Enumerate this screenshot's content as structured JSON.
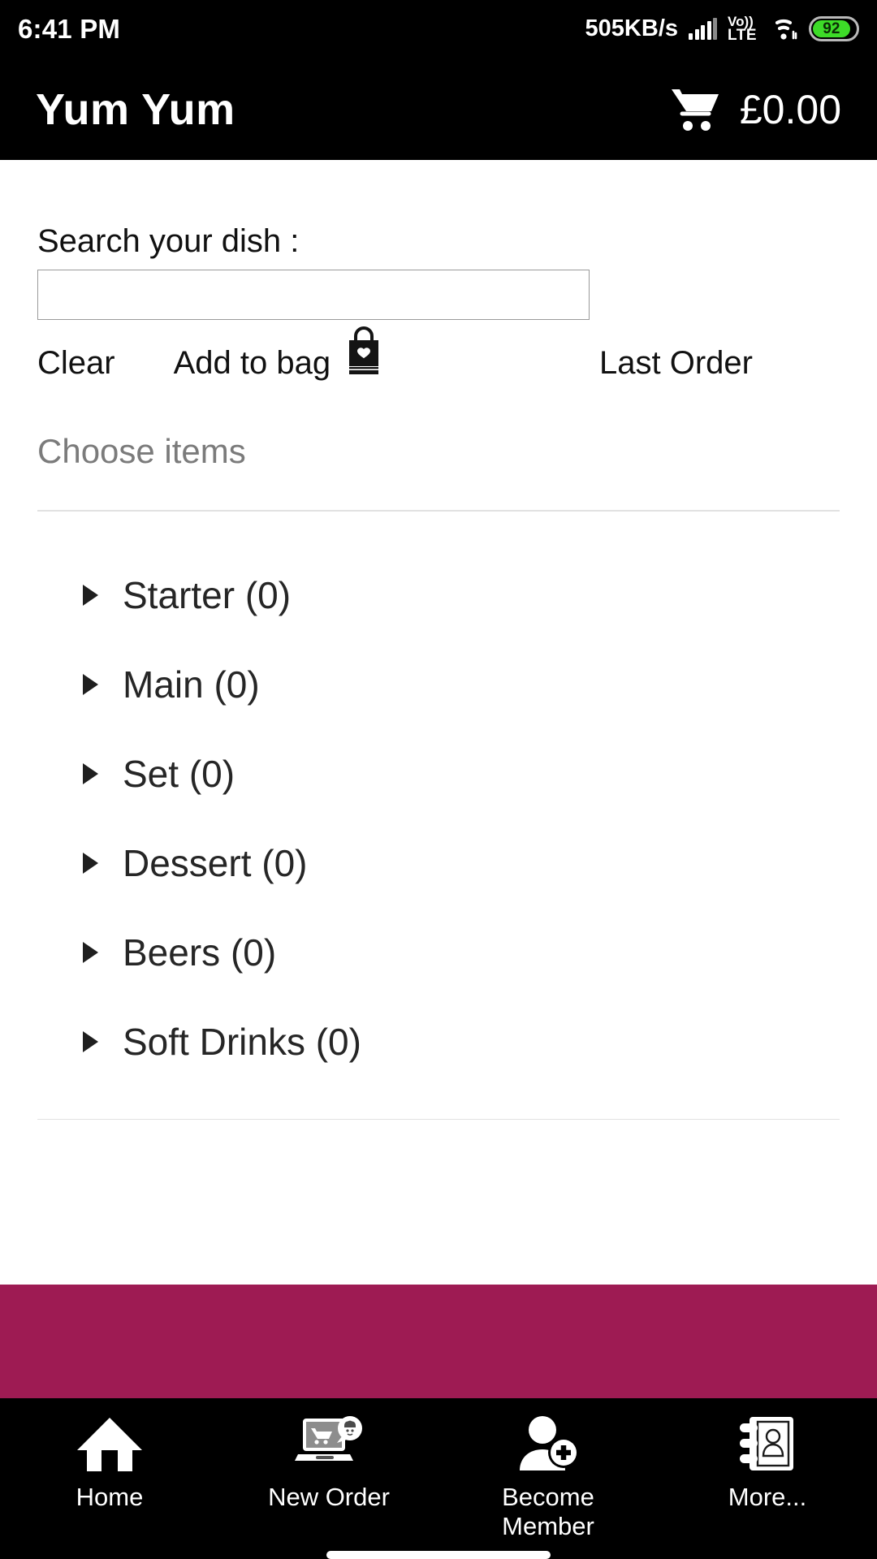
{
  "status_bar": {
    "time": "6:41 PM",
    "network_speed": "505KB/s",
    "signal_icon": "signal-bars-icon",
    "volte_line1": "Vo))",
    "volte_line2": "LTE",
    "wifi_icon": "wifi-icon",
    "battery_level": "92",
    "battery_color": "#3ddc28"
  },
  "app_bar": {
    "title": "Yum Yum",
    "cart_icon": "shopping-cart-icon",
    "cart_total": "£0.00",
    "background": "#000000"
  },
  "search": {
    "label": "Search your dish :",
    "value": "",
    "placeholder": ""
  },
  "actions": {
    "clear_label": "Clear",
    "add_to_bag_label": "Add to bag",
    "bag_icon": "shopping-bag-heart-icon",
    "last_order_label": "Last Order"
  },
  "menu": {
    "section_title": "Choose items",
    "categories": [
      {
        "label": "Starter (0)"
      },
      {
        "label": "Main (0)"
      },
      {
        "label": "Set (0)"
      },
      {
        "label": "Dessert (0)"
      },
      {
        "label": "Beers (0)"
      },
      {
        "label": "Soft Drinks (0)"
      }
    ]
  },
  "accent_band": {
    "color": "#9e1b53"
  },
  "bottom_nav": {
    "items": [
      {
        "label": "Home",
        "icon": "home-icon"
      },
      {
        "label": "New Order",
        "icon": "laptop-cart-chef-icon"
      },
      {
        "label": "Become\nMember",
        "icon": "add-person-icon"
      },
      {
        "label": "More...",
        "icon": "address-book-icon"
      }
    ]
  }
}
